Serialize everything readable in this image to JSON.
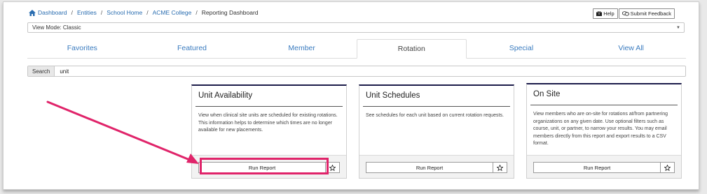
{
  "breadcrumb": {
    "items": [
      "Dashboard",
      "Entities",
      "School Home",
      "ACME College"
    ],
    "current": "Reporting Dashboard",
    "separator": "/"
  },
  "toolbar": {
    "help_label": "Help",
    "feedback_label": "Submit Feedback"
  },
  "view_mode": {
    "value": "View Mode: Classic"
  },
  "tabs": [
    {
      "label": "Favorites"
    },
    {
      "label": "Featured"
    },
    {
      "label": "Member"
    },
    {
      "label": "Rotation",
      "active": true
    },
    {
      "label": "Special"
    },
    {
      "label": "View All"
    }
  ],
  "search": {
    "label": "Search",
    "value": "unit"
  },
  "cards": [
    {
      "title": "Unit Availability",
      "description": "View when clinical site units are scheduled for existing rotations. This information helps to determine which times are no longer available for new placements.",
      "button_label": "Run Report"
    },
    {
      "title": "Unit Schedules",
      "description": "See schedules for each unit based on current rotation requests.",
      "button_label": "Run Report"
    },
    {
      "title": "On Site",
      "description": "View members who are on-site for rotations at/from partnering organizations on any given date. Use optional filters such as course, unit, or partner, to narrow your results. You may email members directly from this report and export results to a CSV format.",
      "button_label": "Run Report"
    }
  ],
  "colors": {
    "accent": "#e0246a",
    "link": "#2a6db0",
    "card_border_top": "#1c1c4a"
  },
  "icons": {
    "home": "home-icon",
    "help": "briefcase-icon",
    "feedback": "chat-icon",
    "star": "star-icon"
  }
}
